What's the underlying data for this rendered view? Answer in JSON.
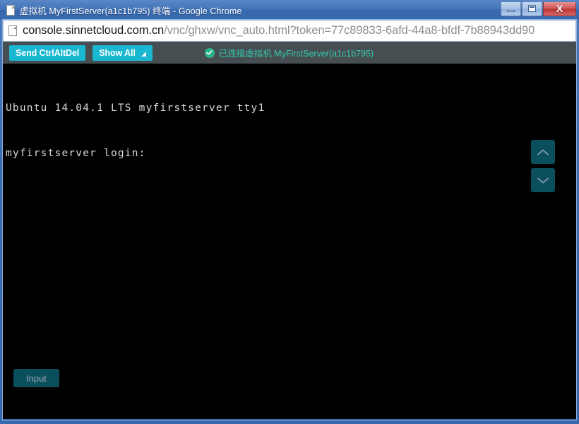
{
  "window": {
    "title": "虚拟机 MyFirstServer(a1c1b795) 终端 - Google Chrome",
    "title_icon": "page-icon",
    "controls": {
      "minimize_label": "–",
      "maximize_label": "□",
      "close_label": "X"
    },
    "frame_color": "#3767ad"
  },
  "address_bar": {
    "icon": "page-icon",
    "host": "console.sinnetcloud.com.cn",
    "path": "/vnc/ghxw/vnc_auto.html?token=77c89833-6afd-44a8-bfdf-7b88943dd90"
  },
  "vnc_toolbar": {
    "background": "#464e51",
    "accent": "#1ab7d1",
    "send_ctrlaltdel_label": "Send CtrlAltDel",
    "show_all_label": "Show All",
    "show_all_caret": "triangle-down-icon",
    "status_icon": "check-circle-icon",
    "status_text": "已连接虚拟机 MyFirstServer(a1c1b795)",
    "status_color": "#35c9b0"
  },
  "terminal": {
    "background": "#000000",
    "text_color": "#d8d8d8",
    "lines": [
      "Ubuntu 14.04.1 LTS myfirstserver tty1",
      "",
      "myfirstserver login:"
    ],
    "content": "Ubuntu 14.04.1 LTS myfirstserver tty1\n\nmyfirstserver login:"
  },
  "overlay_controls": {
    "scroll_up_icon": "chevron-up-icon",
    "scroll_down_icon": "chevron-down-icon",
    "button_color": "#0b4f5e",
    "input_button_label": "Input"
  }
}
